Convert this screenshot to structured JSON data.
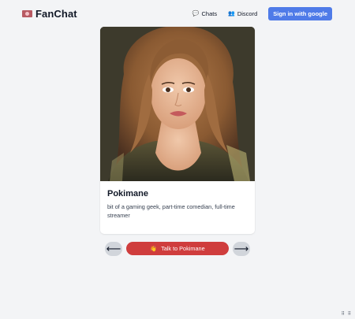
{
  "header": {
    "brand_name": "FanChat",
    "brand_icon": "heart-envelope-icon",
    "nav": [
      {
        "label": "Chats",
        "icon": "speech-bubble-icon"
      },
      {
        "label": "Discord",
        "icon": "people-icon"
      }
    ],
    "signin_label": "Sign in with google"
  },
  "card": {
    "title": "Pokimane",
    "description": "bit of a gaming geek, part-time comedian, full-time streamer",
    "image_alt": "portrait"
  },
  "controls": {
    "prev_icon": "left-arrow-icon",
    "next_icon": "right-arrow-icon",
    "prev_glyph": "⟵",
    "next_glyph": "⟶",
    "talk_label": "Talk to Pokimane",
    "talk_icon": "waving-hand-icon"
  },
  "colors": {
    "background": "#f3f4f6",
    "accent_blue": "#4f7be8",
    "accent_red": "#cf3d3d",
    "arrow_bg": "#d1d5db"
  }
}
